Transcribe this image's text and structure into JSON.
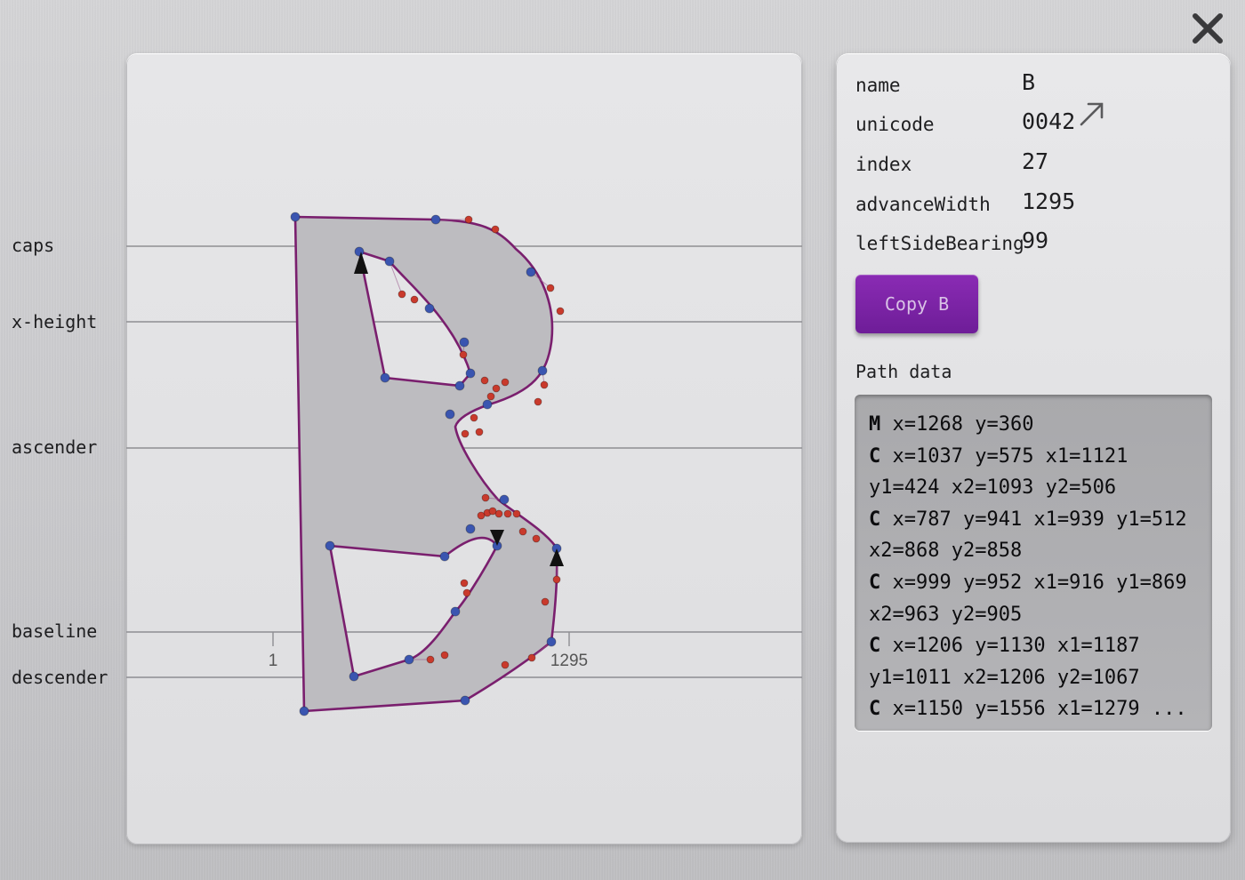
{
  "window": {
    "close_icon": "close-icon"
  },
  "guides": {
    "caps": "caps",
    "x_height": "x-height",
    "ascender": "ascender",
    "baseline": "baseline",
    "descender": "descender"
  },
  "canvas": {
    "left_bearing_label": "1",
    "advance_label": "1295",
    "colors": {
      "fill": "#bdbcc0",
      "outline": "#7a1f6e",
      "on_curve": "#3a55b0",
      "off_curve": "#c93a2c"
    }
  },
  "glyph": {
    "name_label": "name",
    "name": "B",
    "unicode_label": "unicode",
    "unicode": "0042",
    "unicode_link_icon": "arrow-up-right-icon",
    "index_label": "index",
    "index": "27",
    "advance_width_label": "advanceWidth",
    "advance_width": "1295",
    "left_side_bearing_label": "leftSideBearing",
    "left_side_bearing": "99"
  },
  "actions": {
    "copy_label": "Copy B",
    "accent": "#7b25a6"
  },
  "path_data": {
    "heading": "Path data",
    "lines": [
      {
        "cmd": "M",
        "text": " x=1268 y=360"
      },
      {
        "cmd": "C",
        "text": " x=1037 y=575 x1=1121"
      },
      {
        "cmd": "",
        "text": "y1=424 x2=1093 y2=506"
      },
      {
        "cmd": "C",
        "text": " x=787 y=941 x1=939 y1=512"
      },
      {
        "cmd": "",
        "text": "x2=868 y2=858"
      },
      {
        "cmd": "C",
        "text": " x=999 y=952 x1=916 y1=869"
      },
      {
        "cmd": "",
        "text": "x2=963 y2=905"
      },
      {
        "cmd": "C",
        "text": " x=1206 y=1130 x1=1187"
      },
      {
        "cmd": "",
        "text": "y1=1011 x2=1206 y2=1067"
      },
      {
        "cmd": "C",
        "text": " x=1150 y=1556 x1=1279 ..."
      }
    ]
  }
}
